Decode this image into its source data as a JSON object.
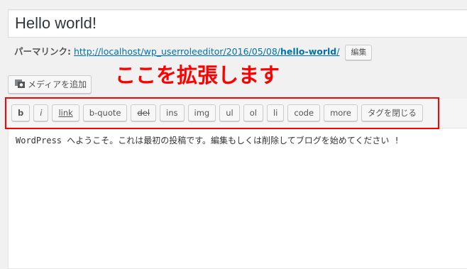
{
  "post": {
    "title": "Hello world!"
  },
  "permalink": {
    "label": "パーマリンク:",
    "url_prefix": "http://localhost/wp_userroleeditor/2016/05/08/",
    "url_slug": "hello-world",
    "url_suffix": "/",
    "edit_label": "編集"
  },
  "media": {
    "add_label": "メディアを追加",
    "icon": "media-camera-icon"
  },
  "annotation": {
    "text": "ここを拡張します",
    "color": "#ff0000"
  },
  "quicktags": [
    {
      "label": "b"
    },
    {
      "label": "i"
    },
    {
      "label": "link"
    },
    {
      "label": "b-quote"
    },
    {
      "label": "del"
    },
    {
      "label": "ins"
    },
    {
      "label": "img"
    },
    {
      "label": "ul"
    },
    {
      "label": "ol"
    },
    {
      "label": "li"
    },
    {
      "label": "code"
    },
    {
      "label": "more"
    },
    {
      "label": "タグを閉じる"
    }
  ],
  "editor": {
    "content": "WordPress へようこそ。これは最初の投稿です。編集もしくは削除してブログを始めてください !"
  }
}
